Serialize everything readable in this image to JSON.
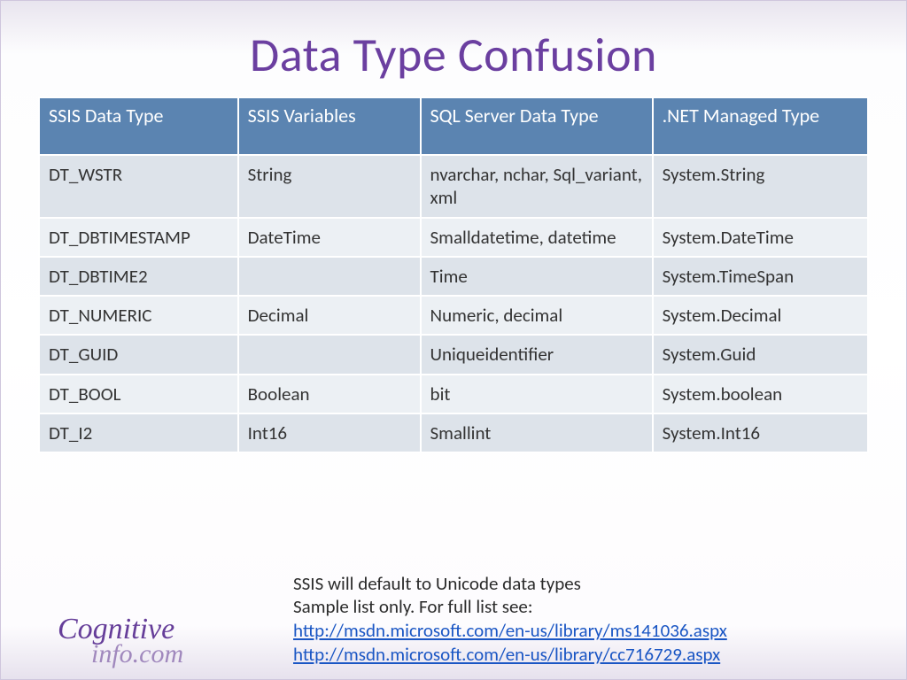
{
  "title": "Data Type Confusion",
  "table": {
    "headers": [
      "SSIS Data Type",
      "SSIS Variables",
      "SQL Server Data Type",
      ".NET Managed Type"
    ],
    "rows": [
      [
        "DT_WSTR",
        "String",
        "nvarchar, nchar, Sql_variant, xml",
        "System.String"
      ],
      [
        "DT_DBTIMESTAMP",
        "DateTime",
        "Smalldatetime, datetime",
        "System.DateTime"
      ],
      [
        "DT_DBTIME2",
        "",
        "Time",
        "System.TimeSpan"
      ],
      [
        "DT_NUMERIC",
        "Decimal",
        "Numeric, decimal",
        "System.Decimal"
      ],
      [
        "DT_GUID",
        "",
        "Uniqueidentifier",
        "System.Guid"
      ],
      [
        "DT_BOOL",
        "Boolean",
        "bit",
        "System.boolean"
      ],
      [
        "DT_I2",
        "Int16",
        "Smallint",
        "System.Int16"
      ]
    ]
  },
  "notes": {
    "line1": "SSIS will default to Unicode data types",
    "line2": "Sample list only.  For full list see:",
    "link1": "http://msdn.microsoft.com/en-us/library/ms141036.aspx",
    "link2": "http://msdn.microsoft.com/en-us/library/cc716729.aspx"
  },
  "logo": {
    "line1": "Cognitive",
    "line2": "info.com"
  }
}
